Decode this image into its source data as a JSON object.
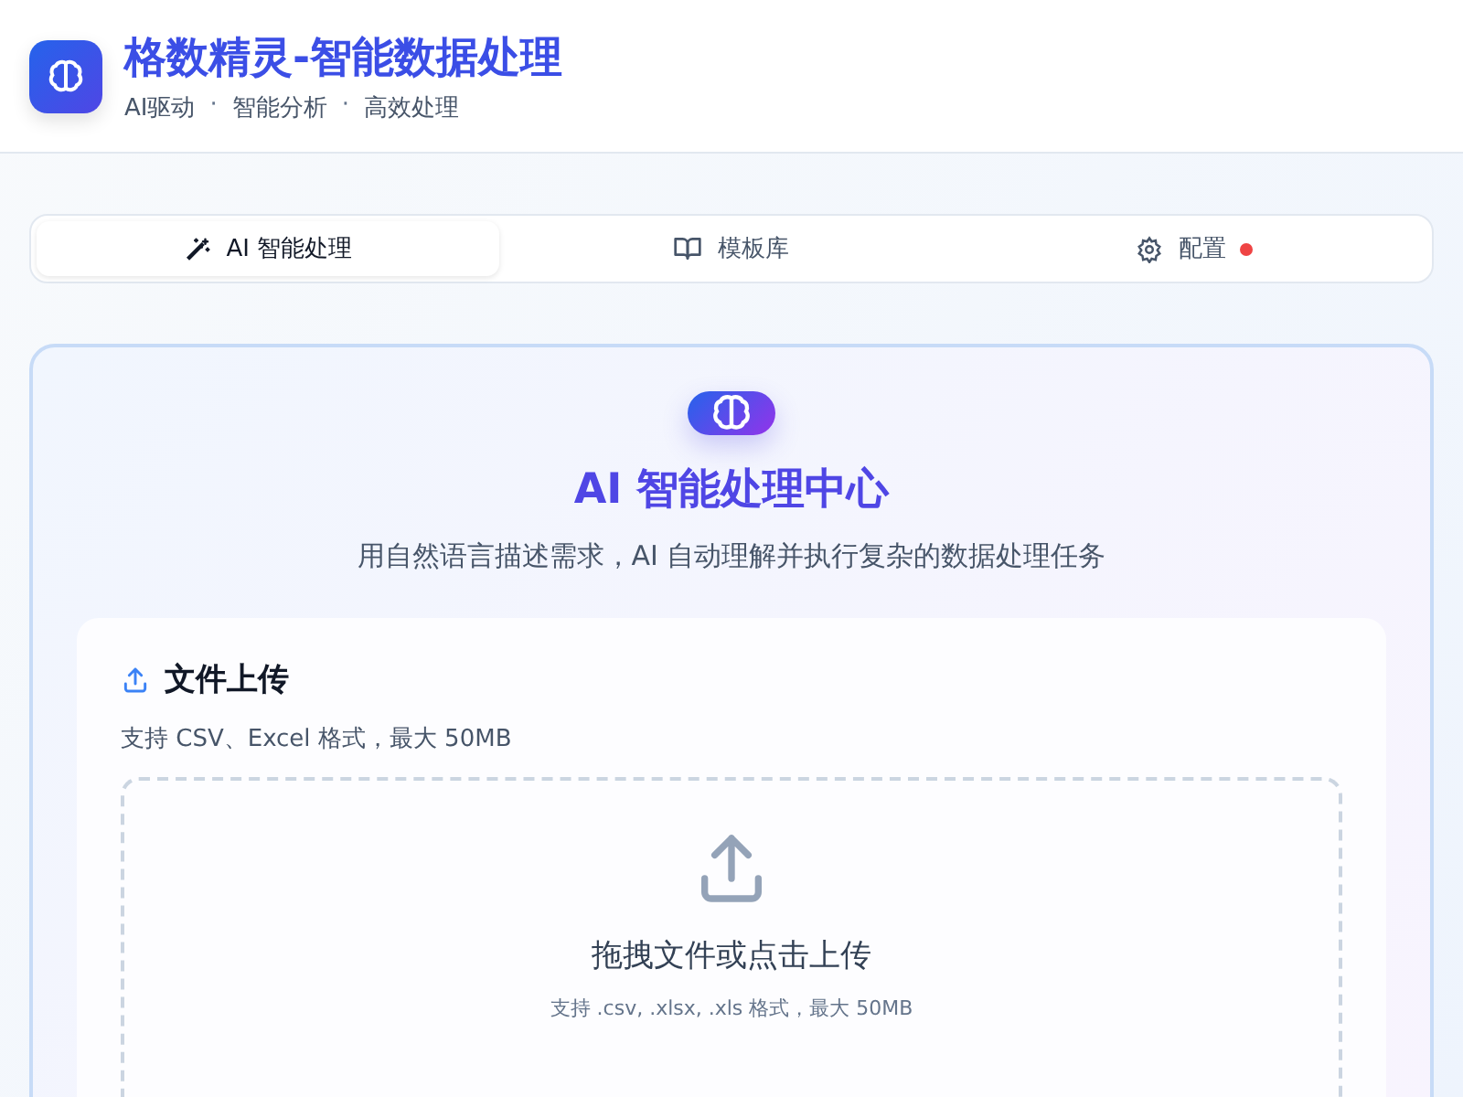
{
  "header": {
    "title": "格数精灵-智能数据处理",
    "taglines": [
      "AI驱动",
      "智能分析",
      "高效处理"
    ],
    "separator": "·"
  },
  "tabs": [
    {
      "kind": "wand",
      "label": "AI 智能处理",
      "selected": true,
      "dot": false
    },
    {
      "kind": "book",
      "label": "模板库",
      "selected": false,
      "dot": false
    },
    {
      "kind": "gear",
      "label": "配置",
      "selected": false,
      "dot": true
    }
  ],
  "hero": {
    "title": "AI 智能处理中心",
    "subtitle": "用自然语言描述需求，AI 自动理解并执行复杂的数据处理任务"
  },
  "upload": {
    "title": "文件上传",
    "hint": "支持 CSV、Excel 格式，最大 50MB",
    "drop_title": "拖拽文件或点击上传",
    "drop_hint": "支持 .csv, .xlsx, .xls 格式，最大 50MB"
  }
}
